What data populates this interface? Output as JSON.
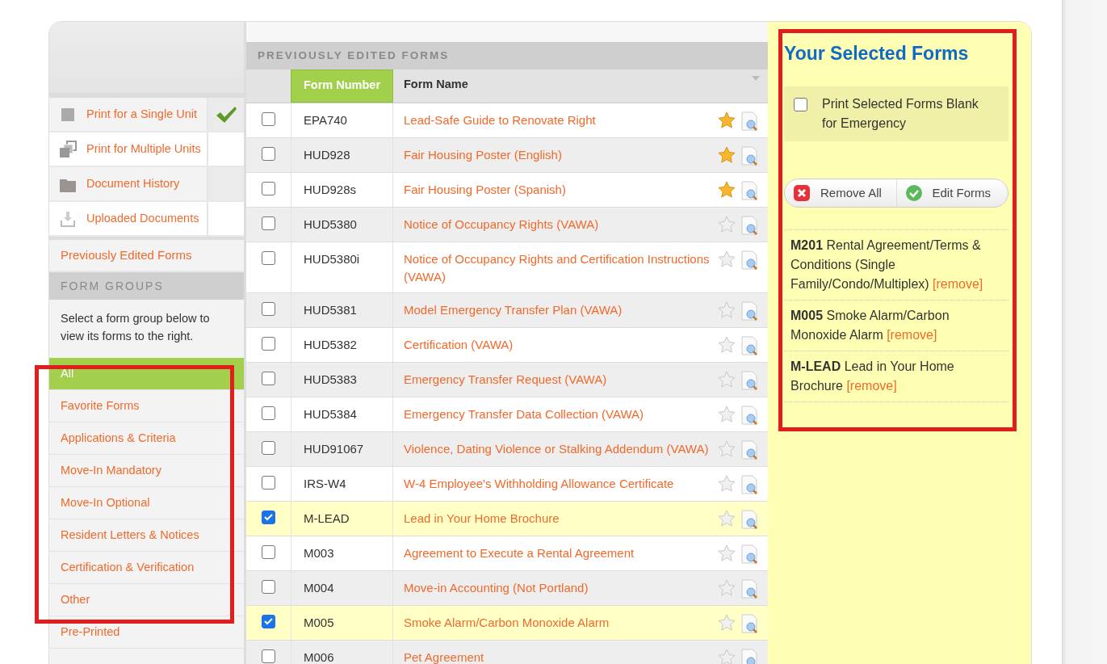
{
  "sidebar": {
    "print_modes": [
      {
        "label": "Print for a Single Unit",
        "kind": "single",
        "checked": true
      },
      {
        "label": "Print for Multiple Units",
        "kind": "multiple",
        "checked": false
      },
      {
        "label": "Document History",
        "kind": "history",
        "checked": false
      },
      {
        "label": "Uploaded Documents",
        "kind": "uploaded",
        "checked": false
      }
    ],
    "previously_edited": "Previously Edited Forms",
    "groups_heading": "FORM GROUPS",
    "groups_hint": "Select a form group below to view its forms to the right.",
    "groups_highlighted": true,
    "groups": [
      {
        "label": "All",
        "selected": true
      },
      {
        "label": "Favorite Forms",
        "selected": false
      },
      {
        "label": "Applications & Criteria",
        "selected": false
      },
      {
        "label": "Move-In Mandatory",
        "selected": false
      },
      {
        "label": "Move-In Optional",
        "selected": false
      },
      {
        "label": "Resident Letters & Notices",
        "selected": false
      },
      {
        "label": "Certification & Verification",
        "selected": false
      },
      {
        "label": "Other",
        "selected": false
      }
    ],
    "after_groups": "Pre-Printed"
  },
  "table": {
    "title": "PREVIOUSLY EDITED FORMS",
    "columns": [
      {
        "label": "Form Number",
        "sorted": true
      },
      {
        "label": "Form Name",
        "sorted": false
      }
    ],
    "rows": [
      {
        "checked": false,
        "number": "EPA740",
        "name": "Lead-Safe Guide to Renovate Right",
        "favorite": true
      },
      {
        "checked": false,
        "number": "HUD928",
        "name": "Fair Housing Poster (English)",
        "favorite": true
      },
      {
        "checked": false,
        "number": "HUD928s",
        "name": "Fair Housing Poster (Spanish)",
        "favorite": true
      },
      {
        "checked": false,
        "number": "HUD5380",
        "name": "Notice of Occupancy Rights (VAWA)",
        "favorite": false
      },
      {
        "checked": false,
        "number": "HUD5380i",
        "name": "Notice of Occupancy Rights and Certification Instructions (VAWA)",
        "favorite": false
      },
      {
        "checked": false,
        "number": "HUD5381",
        "name": "Model Emergency Transfer Plan (VAWA)",
        "favorite": false
      },
      {
        "checked": false,
        "number": "HUD5382",
        "name": "Certification (VAWA)",
        "favorite": false
      },
      {
        "checked": false,
        "number": "HUD5383",
        "name": "Emergency Transfer Request (VAWA)",
        "favorite": false
      },
      {
        "checked": false,
        "number": "HUD5384",
        "name": "Emergency Transfer Data Collection (VAWA)",
        "favorite": false
      },
      {
        "checked": false,
        "number": "HUD91067",
        "name": "Violence, Dating Violence or Stalking Addendum (VAWA)",
        "favorite": false
      },
      {
        "checked": false,
        "number": "IRS-W4",
        "name": "W-4 Employee's Withholding Allowance Certificate",
        "favorite": false
      },
      {
        "checked": true,
        "number": "M-LEAD",
        "name": "Lead in Your Home Brochure",
        "favorite": false
      },
      {
        "checked": false,
        "number": "M003",
        "name": "Agreement to Execute a Rental Agreement",
        "favorite": false
      },
      {
        "checked": false,
        "number": "M004",
        "name": "Move-in Accounting (Not Portland)",
        "favorite": false
      },
      {
        "checked": true,
        "number": "M005",
        "name": "Smoke Alarm/Carbon Monoxide Alarm",
        "favorite": false
      },
      {
        "checked": false,
        "number": "M006",
        "name": "Pet Agreement",
        "favorite": false
      }
    ]
  },
  "selected_panel": {
    "title": "Your Selected Forms",
    "highlighted": true,
    "blank_option": {
      "label": "Print Selected Forms Blank for Emergency",
      "checked": false
    },
    "buttons": [
      {
        "label": "Remove All",
        "kind": "remove"
      },
      {
        "label": "Edit Forms",
        "kind": "edit"
      }
    ],
    "items": [
      {
        "number": "M201",
        "name": "Rental Agreement/Terms & Conditions (Single Family/Condo/Multiplex)",
        "action": "[remove]"
      },
      {
        "number": "M005",
        "name": "Smoke Alarm/Carbon Monoxide Alarm",
        "action": "[remove]"
      },
      {
        "number": "M-LEAD",
        "name": "Lead in Your Home Brochure",
        "action": "[remove]"
      }
    ]
  }
}
